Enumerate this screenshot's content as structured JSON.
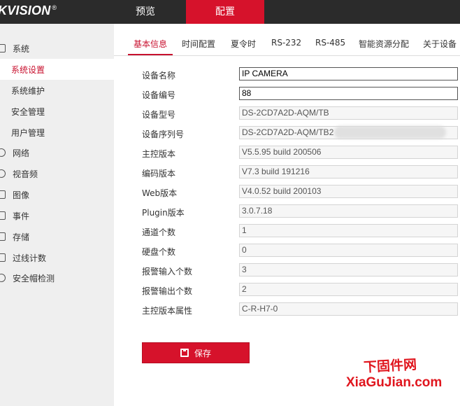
{
  "header": {
    "logo": "KVISION",
    "logo_mark": "®",
    "nav": [
      {
        "label": "预览"
      },
      {
        "label": "配置"
      }
    ]
  },
  "sidebar": {
    "items": [
      {
        "label": "系统",
        "icon": "system-icon"
      },
      {
        "label": "系统设置"
      },
      {
        "label": "系统维护"
      },
      {
        "label": "安全管理"
      },
      {
        "label": "用户管理"
      },
      {
        "label": "网络",
        "icon": "network-icon"
      },
      {
        "label": "视音频",
        "icon": "audio-video-icon"
      },
      {
        "label": "图像",
        "icon": "image-icon"
      },
      {
        "label": "事件",
        "icon": "event-icon"
      },
      {
        "label": "存储",
        "icon": "storage-icon"
      },
      {
        "label": "过线计数",
        "icon": "line-count-icon"
      },
      {
        "label": "安全帽检测",
        "icon": "helmet-detection-icon"
      }
    ]
  },
  "tabs": [
    {
      "label": "基本信息"
    },
    {
      "label": "时间配置"
    },
    {
      "label": "夏令时"
    },
    {
      "label": "RS-232"
    },
    {
      "label": "RS-485"
    },
    {
      "label": "智能资源分配"
    },
    {
      "label": "关于设备"
    }
  ],
  "form": {
    "fields": [
      {
        "label": "设备名称",
        "value": "IP CAMERA"
      },
      {
        "label": "设备编号",
        "value": "88"
      },
      {
        "label": "设备型号",
        "value": "DS-2CD7A2D-AQM/TB"
      },
      {
        "label": "设备序列号",
        "value": "DS-2CD7A2D-AQM/TB2"
      },
      {
        "label": "主控版本",
        "value": "V5.5.95 build 200506"
      },
      {
        "label": "编码版本",
        "value": "V7.3 build 191216"
      },
      {
        "label": "Web版本",
        "value": "V4.0.52 build 200103"
      },
      {
        "label": "Plugin版本",
        "value": "3.0.7.18"
      },
      {
        "label": "通道个数",
        "value": "1"
      },
      {
        "label": "硬盘个数",
        "value": "0"
      },
      {
        "label": "报警输入个数",
        "value": "3"
      },
      {
        "label": "报警输出个数",
        "value": "2"
      },
      {
        "label": "主控版本属性",
        "value": "C-R-H7-0"
      }
    ],
    "save_label": "保存",
    "save_icon": "save-disk-icon"
  },
  "watermark": {
    "line1": "下固件网",
    "line2": "XiaGuJian.com"
  },
  "colors": {
    "accent": "#d6122b",
    "topbar": "#2b2b2b",
    "sidebar": "#efefef"
  }
}
